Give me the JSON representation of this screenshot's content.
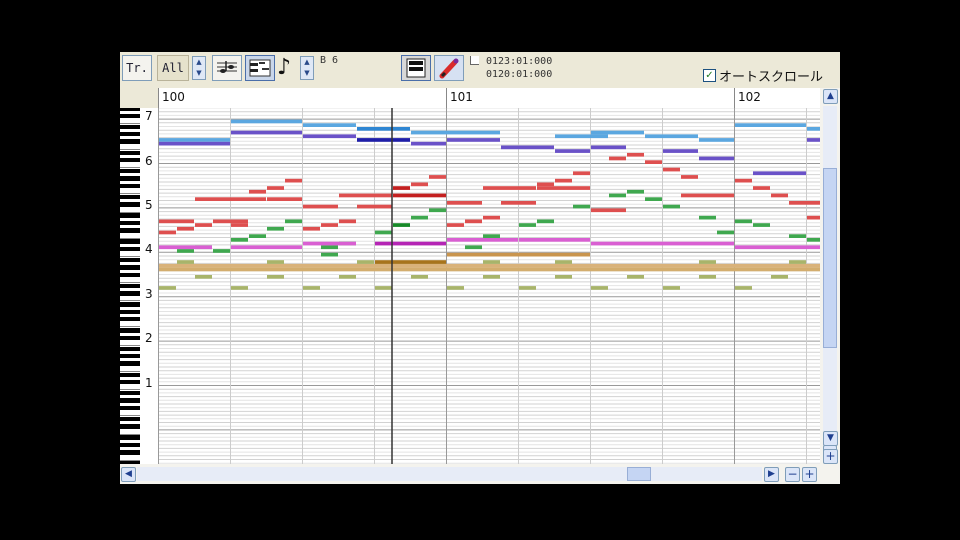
{
  "toolbar": {
    "track_label": "Tr.",
    "track_value": "All",
    "note_icon_glyph": "♪",
    "note_value": "B 6",
    "position_top": "0123:01:000",
    "position_bottom": "0120:01:000",
    "autoscroll_label": "オートスクロール",
    "autoscroll_checked": true
  },
  "ruler": {
    "measures": [
      {
        "label": "100",
        "tick": 0
      },
      {
        "label": "101",
        "tick": 16
      },
      {
        "label": "102",
        "tick": 32
      }
    ]
  },
  "keyboard": {
    "octave_labels": [
      "7",
      "6",
      "5",
      "4",
      "3",
      "2",
      "1"
    ]
  },
  "playhead_tick": 13,
  "notes": [
    {
      "t": 4,
      "d": 4,
      "p": 95,
      "c": "#5ba7e0"
    },
    {
      "t": 8,
      "d": 3,
      "p": 94,
      "c": "#5ba7e0"
    },
    {
      "t": 11,
      "d": 3,
      "p": 93,
      "c": "#2f86d2"
    },
    {
      "t": 14,
      "d": 5,
      "p": 92,
      "c": "#5ba7e0"
    },
    {
      "t": 22,
      "d": 3,
      "p": 91,
      "c": "#5ba7e0"
    },
    {
      "t": 24,
      "d": 3,
      "p": 92,
      "c": "#5ba7e0"
    },
    {
      "t": 27,
      "d": 3,
      "p": 91,
      "c": "#5ba7e0"
    },
    {
      "t": 30,
      "d": 2,
      "p": 90,
      "c": "#5ba7e0"
    },
    {
      "t": 32,
      "d": 4,
      "p": 94,
      "c": "#5ba7e0"
    },
    {
      "t": 36,
      "d": 1,
      "p": 93,
      "c": "#5ba7e0"
    },
    {
      "t": 0,
      "d": 4,
      "p": 90,
      "c": "#5ba7e0"
    },
    {
      "t": 4,
      "d": 4,
      "p": 92,
      "c": "#6a52c8"
    },
    {
      "t": 8,
      "d": 3,
      "p": 91,
      "c": "#6a52c8"
    },
    {
      "t": 11,
      "d": 3,
      "p": 90,
      "c": "#1e1ea8"
    },
    {
      "t": 14,
      "d": 2,
      "p": 89,
      "c": "#6a52c8"
    },
    {
      "t": 16,
      "d": 3,
      "p": 90,
      "c": "#6a52c8"
    },
    {
      "t": 19,
      "d": 3,
      "p": 88,
      "c": "#6a52c8"
    },
    {
      "t": 22,
      "d": 2,
      "p": 87,
      "c": "#6a52c8"
    },
    {
      "t": 24,
      "d": 2,
      "p": 88,
      "c": "#6a52c8"
    },
    {
      "t": 28,
      "d": 2,
      "p": 87,
      "c": "#6a52c8"
    },
    {
      "t": 30,
      "d": 2,
      "p": 85,
      "c": "#6a52c8"
    },
    {
      "t": 33,
      "d": 3,
      "p": 81,
      "c": "#6a52c8"
    },
    {
      "t": 36,
      "d": 1,
      "p": 90,
      "c": "#6a52c8"
    },
    {
      "t": 0,
      "d": 4,
      "p": 89,
      "c": "#6a52c8"
    },
    {
      "t": 0,
      "d": 2,
      "p": 68,
      "c": "#de4f4f"
    },
    {
      "t": 1,
      "d": 1,
      "p": 66,
      "c": "#de4f4f"
    },
    {
      "t": 2,
      "d": 1,
      "p": 67,
      "c": "#de4f4f"
    },
    {
      "t": 0,
      "d": 1,
      "p": 65,
      "c": "#de4f4f"
    },
    {
      "t": 2,
      "d": 4,
      "p": 74,
      "c": "#de4f4f"
    },
    {
      "t": 3,
      "d": 2,
      "p": 68,
      "c": "#de4f4f"
    },
    {
      "t": 4,
      "d": 1,
      "p": 67,
      "c": "#de4f4f"
    },
    {
      "t": 5,
      "d": 1,
      "p": 76,
      "c": "#de4f4f"
    },
    {
      "t": 6,
      "d": 1,
      "p": 77,
      "c": "#de4f4f"
    },
    {
      "t": 7,
      "d": 1,
      "p": 79,
      "c": "#de4f4f"
    },
    {
      "t": 6,
      "d": 2,
      "p": 74,
      "c": "#de4f4f"
    },
    {
      "t": 8,
      "d": 2,
      "p": 72,
      "c": "#de4f4f"
    },
    {
      "t": 8,
      "d": 1,
      "p": 66,
      "c": "#de4f4f"
    },
    {
      "t": 9,
      "d": 1,
      "p": 67,
      "c": "#de4f4f"
    },
    {
      "t": 10,
      "d": 1,
      "p": 68,
      "c": "#de4f4f"
    },
    {
      "t": 10,
      "d": 3,
      "p": 75,
      "c": "#de4f4f"
    },
    {
      "t": 11,
      "d": 2,
      "p": 72,
      "c": "#de4f4f"
    },
    {
      "t": 13,
      "d": 1,
      "p": 77,
      "c": "#c42020"
    },
    {
      "t": 13,
      "d": 3,
      "p": 75,
      "c": "#c42020"
    },
    {
      "t": 14,
      "d": 1,
      "p": 78,
      "c": "#de4f4f"
    },
    {
      "t": 15,
      "d": 1,
      "p": 80,
      "c": "#de4f4f"
    },
    {
      "t": 16,
      "d": 2,
      "p": 73,
      "c": "#de4f4f"
    },
    {
      "t": 16,
      "d": 1,
      "p": 67,
      "c": "#de4f4f"
    },
    {
      "t": 17,
      "d": 1,
      "p": 68,
      "c": "#de4f4f"
    },
    {
      "t": 18,
      "d": 1,
      "p": 69,
      "c": "#de4f4f"
    },
    {
      "t": 18,
      "d": 3,
      "p": 77,
      "c": "#de4f4f"
    },
    {
      "t": 19,
      "d": 2,
      "p": 73,
      "c": "#de4f4f"
    },
    {
      "t": 21,
      "d": 3,
      "p": 77,
      "c": "#de4f4f"
    },
    {
      "t": 21,
      "d": 1,
      "p": 78,
      "c": "#de4f4f"
    },
    {
      "t": 22,
      "d": 1,
      "p": 79,
      "c": "#de4f4f"
    },
    {
      "t": 23,
      "d": 1,
      "p": 81,
      "c": "#de4f4f"
    },
    {
      "t": 24,
      "d": 2,
      "p": 71,
      "c": "#de4f4f"
    },
    {
      "t": 25,
      "d": 1,
      "p": 85,
      "c": "#de4f4f"
    },
    {
      "t": 26,
      "d": 1,
      "p": 86,
      "c": "#de4f4f"
    },
    {
      "t": 27,
      "d": 1,
      "p": 84,
      "c": "#de4f4f"
    },
    {
      "t": 28,
      "d": 1,
      "p": 82,
      "c": "#de4f4f"
    },
    {
      "t": 29,
      "d": 1,
      "p": 80,
      "c": "#de4f4f"
    },
    {
      "t": 29,
      "d": 3,
      "p": 75,
      "c": "#de4f4f"
    },
    {
      "t": 32,
      "d": 1,
      "p": 79,
      "c": "#de4f4f"
    },
    {
      "t": 33,
      "d": 1,
      "p": 77,
      "c": "#de4f4f"
    },
    {
      "t": 34,
      "d": 1,
      "p": 75,
      "c": "#de4f4f"
    },
    {
      "t": 35,
      "d": 2,
      "p": 73,
      "c": "#de4f4f"
    },
    {
      "t": 36,
      "d": 1,
      "p": 69,
      "c": "#de4f4f"
    },
    {
      "t": 1,
      "d": 1,
      "p": 60,
      "c": "#3fa84f"
    },
    {
      "t": 2,
      "d": 1,
      "p": 61,
      "c": "#3fa84f"
    },
    {
      "t": 4,
      "d": 1,
      "p": 63,
      "c": "#3fa84f"
    },
    {
      "t": 5,
      "d": 1,
      "p": 64,
      "c": "#3fa84f"
    },
    {
      "t": 6,
      "d": 1,
      "p": 66,
      "c": "#3fa84f"
    },
    {
      "t": 7,
      "d": 1,
      "p": 68,
      "c": "#3fa84f"
    },
    {
      "t": 9,
      "d": 1,
      "p": 61,
      "c": "#3fa84f"
    },
    {
      "t": 10,
      "d": 1,
      "p": 62,
      "c": "#3fa84f"
    },
    {
      "t": 12,
      "d": 1,
      "p": 65,
      "c": "#3fa84f"
    },
    {
      "t": 13,
      "d": 1,
      "p": 67,
      "c": "#168a28"
    },
    {
      "t": 14,
      "d": 1,
      "p": 69,
      "c": "#3fa84f"
    },
    {
      "t": 15,
      "d": 1,
      "p": 71,
      "c": "#3fa84f"
    },
    {
      "t": 17,
      "d": 1,
      "p": 61,
      "c": "#3fa84f"
    },
    {
      "t": 18,
      "d": 1,
      "p": 64,
      "c": "#3fa84f"
    },
    {
      "t": 20,
      "d": 1,
      "p": 67,
      "c": "#3fa84f"
    },
    {
      "t": 21,
      "d": 1,
      "p": 68,
      "c": "#3fa84f"
    },
    {
      "t": 23,
      "d": 1,
      "p": 72,
      "c": "#3fa84f"
    },
    {
      "t": 25,
      "d": 1,
      "p": 75,
      "c": "#3fa84f"
    },
    {
      "t": 26,
      "d": 1,
      "p": 76,
      "c": "#3fa84f"
    },
    {
      "t": 27,
      "d": 1,
      "p": 74,
      "c": "#3fa84f"
    },
    {
      "t": 28,
      "d": 1,
      "p": 72,
      "c": "#3fa84f"
    },
    {
      "t": 30,
      "d": 1,
      "p": 69,
      "c": "#3fa84f"
    },
    {
      "t": 31,
      "d": 1,
      "p": 65,
      "c": "#3fa84f"
    },
    {
      "t": 32,
      "d": 1,
      "p": 68,
      "c": "#3fa84f"
    },
    {
      "t": 33,
      "d": 1,
      "p": 67,
      "c": "#3fa84f"
    },
    {
      "t": 35,
      "d": 1,
      "p": 64,
      "c": "#3fa84f"
    },
    {
      "t": 36,
      "d": 1,
      "p": 63,
      "c": "#3fa84f"
    },
    {
      "t": 0,
      "d": 3,
      "p": 61,
      "c": "#d95fd2"
    },
    {
      "t": 4,
      "d": 4,
      "p": 61,
      "c": "#d95fd2"
    },
    {
      "t": 8,
      "d": 3,
      "p": 62,
      "c": "#d95fd2"
    },
    {
      "t": 12,
      "d": 4,
      "p": 62,
      "c": "#b525b5"
    },
    {
      "t": 16,
      "d": 4,
      "p": 63,
      "c": "#d95fd2"
    },
    {
      "t": 20,
      "d": 4,
      "p": 63,
      "c": "#d95fd2"
    },
    {
      "t": 24,
      "d": 8,
      "p": 62,
      "c": "#d95fd2"
    },
    {
      "t": 32,
      "d": 5,
      "p": 61,
      "c": "#d95fd2"
    },
    {
      "t": 0,
      "d": 37,
      "p": 56,
      "c": "#d9b27a"
    },
    {
      "t": 0,
      "d": 37,
      "p": 55,
      "c": "#d3ad6e"
    },
    {
      "t": 16,
      "d": 8,
      "p": 59,
      "c": "#c9954e"
    },
    {
      "t": 12,
      "d": 4,
      "p": 57,
      "c": "#a7741c"
    },
    {
      "t": 1,
      "d": 1,
      "p": 57,
      "c": "#a8b46a"
    },
    {
      "t": 2,
      "d": 1,
      "p": 53,
      "c": "#a8b46a"
    },
    {
      "t": 4,
      "d": 1,
      "p": 50,
      "c": "#a8b46a"
    },
    {
      "t": 6,
      "d": 1,
      "p": 57,
      "c": "#a8b46a"
    },
    {
      "t": 6,
      "d": 1,
      "p": 53,
      "c": "#a8b46a"
    },
    {
      "t": 8,
      "d": 1,
      "p": 50,
      "c": "#a8b46a"
    },
    {
      "t": 10,
      "d": 1,
      "p": 53,
      "c": "#a8b46a"
    },
    {
      "t": 11,
      "d": 1,
      "p": 57,
      "c": "#a8b46a"
    },
    {
      "t": 12,
      "d": 1,
      "p": 50,
      "c": "#a8b46a"
    },
    {
      "t": 14,
      "d": 1,
      "p": 53,
      "c": "#a8b46a"
    },
    {
      "t": 16,
      "d": 1,
      "p": 50,
      "c": "#a8b46a"
    },
    {
      "t": 18,
      "d": 1,
      "p": 53,
      "c": "#a8b46a"
    },
    {
      "t": 18,
      "d": 1,
      "p": 57,
      "c": "#a8b46a"
    },
    {
      "t": 20,
      "d": 1,
      "p": 50,
      "c": "#a8b46a"
    },
    {
      "t": 22,
      "d": 1,
      "p": 53,
      "c": "#a8b46a"
    },
    {
      "t": 22,
      "d": 1,
      "p": 57,
      "c": "#a8b46a"
    },
    {
      "t": 24,
      "d": 1,
      "p": 50,
      "c": "#a8b46a"
    },
    {
      "t": 26,
      "d": 1,
      "p": 53,
      "c": "#a8b46a"
    },
    {
      "t": 28,
      "d": 1,
      "p": 50,
      "c": "#a8b46a"
    },
    {
      "t": 30,
      "d": 1,
      "p": 53,
      "c": "#a8b46a"
    },
    {
      "t": 30,
      "d": 1,
      "p": 57,
      "c": "#a8b46a"
    },
    {
      "t": 32,
      "d": 1,
      "p": 50,
      "c": "#a8b46a"
    },
    {
      "t": 34,
      "d": 1,
      "p": 53,
      "c": "#a8b46a"
    },
    {
      "t": 35,
      "d": 1,
      "p": 57,
      "c": "#a8b46a"
    },
    {
      "t": 0,
      "d": 1,
      "p": 50,
      "c": "#a8b46a"
    },
    {
      "t": 3,
      "d": 1,
      "p": 60,
      "c": "#3fa84f"
    },
    {
      "t": 9,
      "d": 1,
      "p": 59,
      "c": "#3fa84f"
    }
  ]
}
